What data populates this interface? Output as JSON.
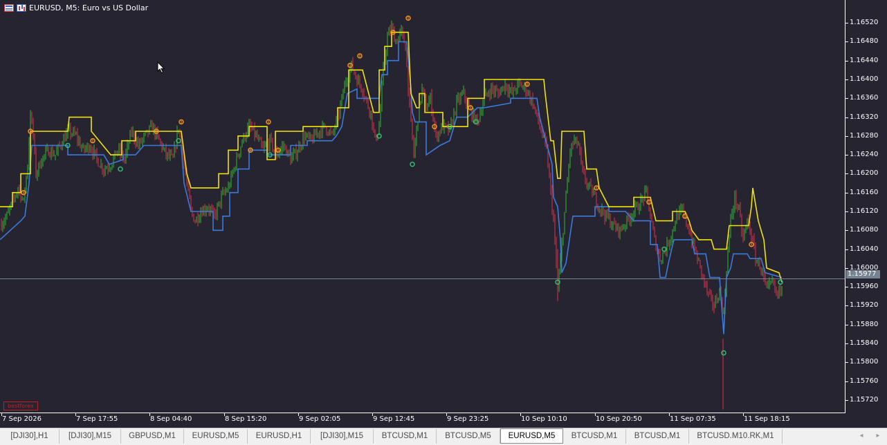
{
  "title": {
    "text": "EURUSD, M5:  Euro vs US Dollar",
    "icons": [
      "one-click-trading-table-icon",
      "chart-bars-icon"
    ]
  },
  "colors": {
    "background": "#262431",
    "axis_text": "#ffffff",
    "grid": "none",
    "bull_candle": "#2eb82e",
    "bear_candle": "#e0304a",
    "upper_stop_line": "#f2e30b",
    "lower_stop_line": "#3a7bdc",
    "sell_signal": "#f7931a",
    "buy_signal": "#2fbf6f",
    "bid_line": "#768392"
  },
  "chart_data": {
    "type": "line",
    "symbol": "EURUSD",
    "timeframe": "M5",
    "ylim": [
      1.15692,
      1.16548
    ],
    "y_ticks": [
      "1.16520",
      "1.16480",
      "1.16440",
      "1.16400",
      "1.16360",
      "1.16320",
      "1.16280",
      "1.16240",
      "1.16200",
      "1.16160",
      "1.16120",
      "1.16080",
      "1.16040",
      "1.16000",
      "1.15960",
      "1.15920",
      "1.15880",
      "1.15840",
      "1.15800",
      "1.15760",
      "1.15720"
    ],
    "x_ticks": [
      "7 Sep 2026",
      "7 Sep 17:55",
      "8 Sep 04:40",
      "8 Sep 15:20",
      "9 Sep 02:05",
      "9 Sep 12:45",
      "9 Sep 23:25",
      "10 Sep 10:10",
      "10 Sep 20:50",
      "11 Sep 07:35",
      "11 Sep 18:15"
    ],
    "current_price": "1.15977",
    "price_path": [
      [
        0,
        1.1609
      ],
      [
        10,
        1.1611
      ],
      [
        18,
        1.1614
      ],
      [
        26,
        1.1617
      ],
      [
        34,
        1.1614
      ],
      [
        40,
        1.1622
      ],
      [
        44,
        1.1633
      ],
      [
        48,
        1.1628
      ],
      [
        52,
        1.162
      ],
      [
        60,
        1.1623
      ],
      [
        70,
        1.1625
      ],
      [
        80,
        1.1624
      ],
      [
        90,
        1.1627
      ],
      [
        100,
        1.1629
      ],
      [
        110,
        1.1628
      ],
      [
        120,
        1.1625
      ],
      [
        130,
        1.1626
      ],
      [
        140,
        1.1623
      ],
      [
        150,
        1.1621
      ],
      [
        160,
        1.1622
      ],
      [
        170,
        1.1625
      ],
      [
        180,
        1.1623
      ],
      [
        190,
        1.1629
      ],
      [
        200,
        1.1626
      ],
      [
        210,
        1.1628
      ],
      [
        220,
        1.163
      ],
      [
        230,
        1.1627
      ],
      [
        240,
        1.1624
      ],
      [
        250,
        1.1623
      ],
      [
        258,
        1.163
      ],
      [
        262,
        1.1626
      ],
      [
        270,
        1.1618
      ],
      [
        276,
        1.1612
      ],
      [
        282,
        1.161
      ],
      [
        290,
        1.1612
      ],
      [
        300,
        1.1613
      ],
      [
        310,
        1.1611
      ],
      [
        320,
        1.1615
      ],
      [
        330,
        1.1617
      ],
      [
        340,
        1.1622
      ],
      [
        350,
        1.1627
      ],
      [
        360,
        1.163
      ],
      [
        370,
        1.1628
      ],
      [
        380,
        1.1625
      ],
      [
        390,
        1.1627
      ],
      [
        400,
        1.1624
      ],
      [
        410,
        1.1626
      ],
      [
        420,
        1.1623
      ],
      [
        430,
        1.1625
      ],
      [
        440,
        1.1628
      ],
      [
        450,
        1.1627
      ],
      [
        460,
        1.1629
      ],
      [
        470,
        1.163
      ],
      [
        480,
        1.1628
      ],
      [
        490,
        1.1633
      ],
      [
        500,
        1.164
      ],
      [
        508,
        1.1643
      ],
      [
        516,
        1.164
      ],
      [
        524,
        1.1638
      ],
      [
        530,
        1.1635
      ],
      [
        536,
        1.1633
      ],
      [
        542,
        1.1627
      ],
      [
        548,
        1.163
      ],
      [
        554,
        1.1642
      ],
      [
        560,
        1.1649
      ],
      [
        566,
        1.1651
      ],
      [
        572,
        1.1648
      ],
      [
        580,
        1.165
      ],
      [
        586,
        1.1647
      ],
      [
        592,
        1.1634
      ],
      [
        598,
        1.1624
      ],
      [
        604,
        1.1632
      ],
      [
        610,
        1.1638
      ],
      [
        616,
        1.1634
      ],
      [
        622,
        1.1636
      ],
      [
        630,
        1.1628
      ],
      [
        640,
        1.163
      ],
      [
        650,
        1.1629
      ],
      [
        660,
        1.1635
      ],
      [
        670,
        1.1637
      ],
      [
        680,
        1.1633
      ],
      [
        690,
        1.1631
      ],
      [
        700,
        1.1636
      ],
      [
        710,
        1.1638
      ],
      [
        720,
        1.1637
      ],
      [
        730,
        1.1639
      ],
      [
        740,
        1.1637
      ],
      [
        750,
        1.1639
      ],
      [
        760,
        1.1638
      ],
      [
        770,
        1.1635
      ],
      [
        780,
        1.163
      ],
      [
        790,
        1.1625
      ],
      [
        800,
        1.161
      ],
      [
        806,
        1.1595
      ],
      [
        812,
        1.1605
      ],
      [
        818,
        1.1615
      ],
      [
        824,
        1.1625
      ],
      [
        830,
        1.1627
      ],
      [
        836,
        1.1626
      ],
      [
        842,
        1.162
      ],
      [
        848,
        1.1618
      ],
      [
        856,
        1.1616
      ],
      [
        866,
        1.1613
      ],
      [
        876,
        1.1611
      ],
      [
        886,
        1.1609
      ],
      [
        896,
        1.1608
      ],
      [
        906,
        1.161
      ],
      [
        916,
        1.1612
      ],
      [
        926,
        1.1614
      ],
      [
        934,
        1.1616
      ],
      [
        940,
        1.1611
      ],
      [
        946,
        1.1606
      ],
      [
        954,
        1.1602
      ],
      [
        962,
        1.1604
      ],
      [
        970,
        1.1607
      ],
      [
        978,
        1.1611
      ],
      [
        986,
        1.1612
      ],
      [
        994,
        1.1609
      ],
      [
        1002,
        1.1605
      ],
      [
        1010,
        1.1601
      ],
      [
        1016,
        1.1598
      ],
      [
        1024,
        1.1594
      ],
      [
        1032,
        1.1592
      ],
      [
        1040,
        1.1595
      ],
      [
        1046,
        1.159
      ],
      [
        1050,
        1.16
      ],
      [
        1056,
        1.161
      ],
      [
        1062,
        1.1615
      ],
      [
        1068,
        1.1612
      ],
      [
        1074,
        1.1606
      ],
      [
        1080,
        1.161
      ],
      [
        1086,
        1.1607
      ],
      [
        1092,
        1.1602
      ],
      [
        1100,
        1.16
      ],
      [
        1108,
        1.1595
      ],
      [
        1116,
        1.1597
      ],
      [
        1124,
        1.1594
      ],
      [
        1130,
        1.1597
      ]
    ],
    "spikes": [
      {
        "x": 806,
        "low": 1.1593,
        "high": 1.1604
      },
      {
        "x": 1045,
        "low": 1.157,
        "high": 1.1585
      }
    ],
    "upper_line": [
      [
        0,
        1.1613
      ],
      [
        18,
        1.1613
      ],
      [
        18,
        1.1616
      ],
      [
        30,
        1.1616
      ],
      [
        30,
        1.162
      ],
      [
        44,
        1.162
      ],
      [
        44,
        1.1629
      ],
      [
        98,
        1.1629
      ],
      [
        100,
        1.1632
      ],
      [
        132,
        1.1632
      ],
      [
        132,
        1.1629
      ],
      [
        160,
        1.1624
      ],
      [
        176,
        1.1624
      ],
      [
        176,
        1.1627
      ],
      [
        196,
        1.1627
      ],
      [
        196,
        1.1629
      ],
      [
        262,
        1.1629
      ],
      [
        270,
        1.162
      ],
      [
        276,
        1.1617
      ],
      [
        316,
        1.1617
      ],
      [
        316,
        1.162
      ],
      [
        330,
        1.162
      ],
      [
        330,
        1.1625
      ],
      [
        344,
        1.1625
      ],
      [
        344,
        1.1628
      ],
      [
        360,
        1.1628
      ],
      [
        360,
        1.163
      ],
      [
        386,
        1.163
      ],
      [
        386,
        1.1623
      ],
      [
        398,
        1.1623
      ],
      [
        398,
        1.1629
      ],
      [
        438,
        1.1629
      ],
      [
        438,
        1.163
      ],
      [
        488,
        1.163
      ],
      [
        488,
        1.1634
      ],
      [
        504,
        1.1634
      ],
      [
        504,
        1.1642
      ],
      [
        524,
        1.1642
      ],
      [
        540,
        1.1633
      ],
      [
        548,
        1.1633
      ],
      [
        548,
        1.1642
      ],
      [
        556,
        1.1642
      ],
      [
        556,
        1.1647
      ],
      [
        566,
        1.1647
      ],
      [
        566,
        1.165
      ],
      [
        590,
        1.165
      ],
      [
        592,
        1.1643
      ],
      [
        594,
        1.1637
      ],
      [
        602,
        1.1634
      ],
      [
        606,
        1.1634
      ],
      [
        606,
        1.1637
      ],
      [
        614,
        1.1637
      ],
      [
        614,
        1.1633
      ],
      [
        640,
        1.1633
      ],
      [
        640,
        1.163
      ],
      [
        676,
        1.163
      ],
      [
        676,
        1.1636
      ],
      [
        700,
        1.1636
      ],
      [
        700,
        1.164
      ],
      [
        786,
        1.164
      ],
      [
        788,
        1.1637
      ],
      [
        796,
        1.1627
      ],
      [
        800,
        1.1627
      ],
      [
        806,
        1.1619
      ],
      [
        810,
        1.1619
      ],
      [
        812,
        1.1629
      ],
      [
        844,
        1.1629
      ],
      [
        848,
        1.1621
      ],
      [
        862,
        1.1621
      ],
      [
        866,
        1.1617
      ],
      [
        880,
        1.1613
      ],
      [
        916,
        1.1613
      ],
      [
        916,
        1.1615
      ],
      [
        940,
        1.1615
      ],
      [
        948,
        1.161
      ],
      [
        972,
        1.161
      ],
      [
        972,
        1.1612
      ],
      [
        990,
        1.1612
      ],
      [
        996,
        1.161
      ],
      [
        1000,
        1.1608
      ],
      [
        1010,
        1.1606
      ],
      [
        1028,
        1.1606
      ],
      [
        1032,
        1.1604
      ],
      [
        1050,
        1.1604
      ],
      [
        1054,
        1.1609
      ],
      [
        1082,
        1.1609
      ],
      [
        1086,
        1.1613
      ],
      [
        1088,
        1.1617
      ],
      [
        1096,
        1.161
      ],
      [
        1104,
        1.1606
      ],
      [
        1108,
        1.16
      ],
      [
        1126,
        1.1599
      ],
      [
        1130,
        1.1597
      ]
    ],
    "lower_line": [
      [
        0,
        1.1606
      ],
      [
        30,
        1.161
      ],
      [
        36,
        1.1611
      ],
      [
        42,
        1.1618
      ],
      [
        46,
        1.1626
      ],
      [
        98,
        1.1626
      ],
      [
        98,
        1.1624
      ],
      [
        150,
        1.1624
      ],
      [
        158,
        1.1622
      ],
      [
        178,
        1.1623
      ],
      [
        178,
        1.1624
      ],
      [
        196,
        1.1624
      ],
      [
        208,
        1.1626
      ],
      [
        262,
        1.1626
      ],
      [
        266,
        1.1618
      ],
      [
        276,
        1.1612
      ],
      [
        308,
        1.1612
      ],
      [
        308,
        1.1608
      ],
      [
        322,
        1.1608
      ],
      [
        322,
        1.1611
      ],
      [
        332,
        1.1611
      ],
      [
        332,
        1.1616
      ],
      [
        344,
        1.1616
      ],
      [
        344,
        1.1621
      ],
      [
        360,
        1.1621
      ],
      [
        360,
        1.1625
      ],
      [
        386,
        1.1625
      ],
      [
        386,
        1.1624
      ],
      [
        420,
        1.1624
      ],
      [
        420,
        1.1626
      ],
      [
        444,
        1.1626
      ],
      [
        444,
        1.1627
      ],
      [
        480,
        1.1627
      ],
      [
        486,
        1.1628
      ],
      [
        494,
        1.163
      ],
      [
        502,
        1.1637
      ],
      [
        516,
        1.1638
      ],
      [
        516,
        1.1636
      ],
      [
        548,
        1.1636
      ],
      [
        552,
        1.1641
      ],
      [
        560,
        1.1641
      ],
      [
        560,
        1.1644
      ],
      [
        576,
        1.1644
      ],
      [
        576,
        1.1648
      ],
      [
        588,
        1.1648
      ],
      [
        594,
        1.1638
      ],
      [
        596,
        1.1633
      ],
      [
        600,
        1.1631
      ],
      [
        616,
        1.1631
      ],
      [
        616,
        1.1624
      ],
      [
        636,
        1.1626
      ],
      [
        650,
        1.1627
      ],
      [
        660,
        1.1632
      ],
      [
        676,
        1.1632
      ],
      [
        690,
        1.1634
      ],
      [
        700,
        1.1634
      ],
      [
        738,
        1.1635
      ],
      [
        738,
        1.1636
      ],
      [
        776,
        1.1636
      ],
      [
        780,
        1.1632
      ],
      [
        798,
        1.1622
      ],
      [
        800,
        1.1615
      ],
      [
        806,
        1.1613
      ],
      [
        810,
        1.1606
      ],
      [
        812,
        1.1599
      ],
      [
        818,
        1.1601
      ],
      [
        822,
        1.1605
      ],
      [
        828,
        1.1611
      ],
      [
        860,
        1.1611
      ],
      [
        860,
        1.1613
      ],
      [
        880,
        1.1613
      ],
      [
        880,
        1.1612
      ],
      [
        904,
        1.1612
      ],
      [
        916,
        1.161
      ],
      [
        940,
        1.161
      ],
      [
        940,
        1.1605
      ],
      [
        950,
        1.1605
      ],
      [
        954,
        1.1598
      ],
      [
        962,
        1.1598
      ],
      [
        966,
        1.1601
      ],
      [
        974,
        1.1606
      ],
      [
        1000,
        1.1606
      ],
      [
        1004,
        1.1603
      ],
      [
        1020,
        1.1603
      ],
      [
        1026,
        1.1598
      ],
      [
        1040,
        1.1598
      ],
      [
        1044,
        1.159
      ],
      [
        1046,
        1.1586
      ],
      [
        1050,
        1.1598
      ],
      [
        1056,
        1.16
      ],
      [
        1060,
        1.1603
      ],
      [
        1080,
        1.1603
      ],
      [
        1084,
        1.1602
      ],
      [
        1100,
        1.1602
      ],
      [
        1106,
        1.1599
      ],
      [
        1130,
        1.1598
      ]
    ],
    "sell_signals": [
      [
        34,
        1.1616
      ],
      [
        44,
        1.1629
      ],
      [
        134,
        1.1627
      ],
      [
        226,
        1.1629
      ],
      [
        262,
        1.1631
      ],
      [
        362,
        1.1625
      ],
      [
        388,
        1.1631
      ],
      [
        402,
        1.1625
      ],
      [
        506,
        1.1643
      ],
      [
        520,
        1.1645
      ],
      [
        568,
        1.165
      ],
      [
        590,
        1.1653
      ],
      [
        628,
        1.163
      ],
      [
        680,
        1.1634
      ],
      [
        762,
        1.1639
      ],
      [
        862,
        1.1617
      ],
      [
        938,
        1.1614
      ],
      [
        990,
        1.1611
      ],
      [
        1086,
        1.1605
      ]
    ],
    "buy_signals": [
      [
        98,
        1.1626
      ],
      [
        174,
        1.1621
      ],
      [
        258,
        1.1627
      ],
      [
        390,
        1.1624
      ],
      [
        548,
        1.1628
      ],
      [
        596,
        1.1622
      ],
      [
        650,
        1.163
      ],
      [
        688,
        1.1631
      ],
      [
        806,
        1.1597
      ],
      [
        960,
        1.1604
      ],
      [
        1046,
        1.1582
      ],
      [
        1128,
        1.1597
      ]
    ]
  },
  "watermark_text": "bestforex",
  "tabs": [
    {
      "label": "[DJI30],H1",
      "active": false
    },
    {
      "label": "[DJI30],M15",
      "active": false
    },
    {
      "label": "GBPUSD,M1",
      "active": false
    },
    {
      "label": "EURUSD,M5",
      "active": false
    },
    {
      "label": "EURUSD,H1",
      "active": false
    },
    {
      "label": "[DJI30],M15",
      "active": false
    },
    {
      "label": "BTCUSD,M1",
      "active": false
    },
    {
      "label": "BTCUSD,M5",
      "active": false
    },
    {
      "label": "EURUSD,M5",
      "active": true
    },
    {
      "label": "BTCUSD,M1",
      "active": false
    },
    {
      "label": "BTCUSD,M1",
      "active": false
    },
    {
      "label": "BTCUSD.M10.RK,M1",
      "active": false
    }
  ],
  "tab_scroll": {
    "left": "◂",
    "right": "▸"
  }
}
